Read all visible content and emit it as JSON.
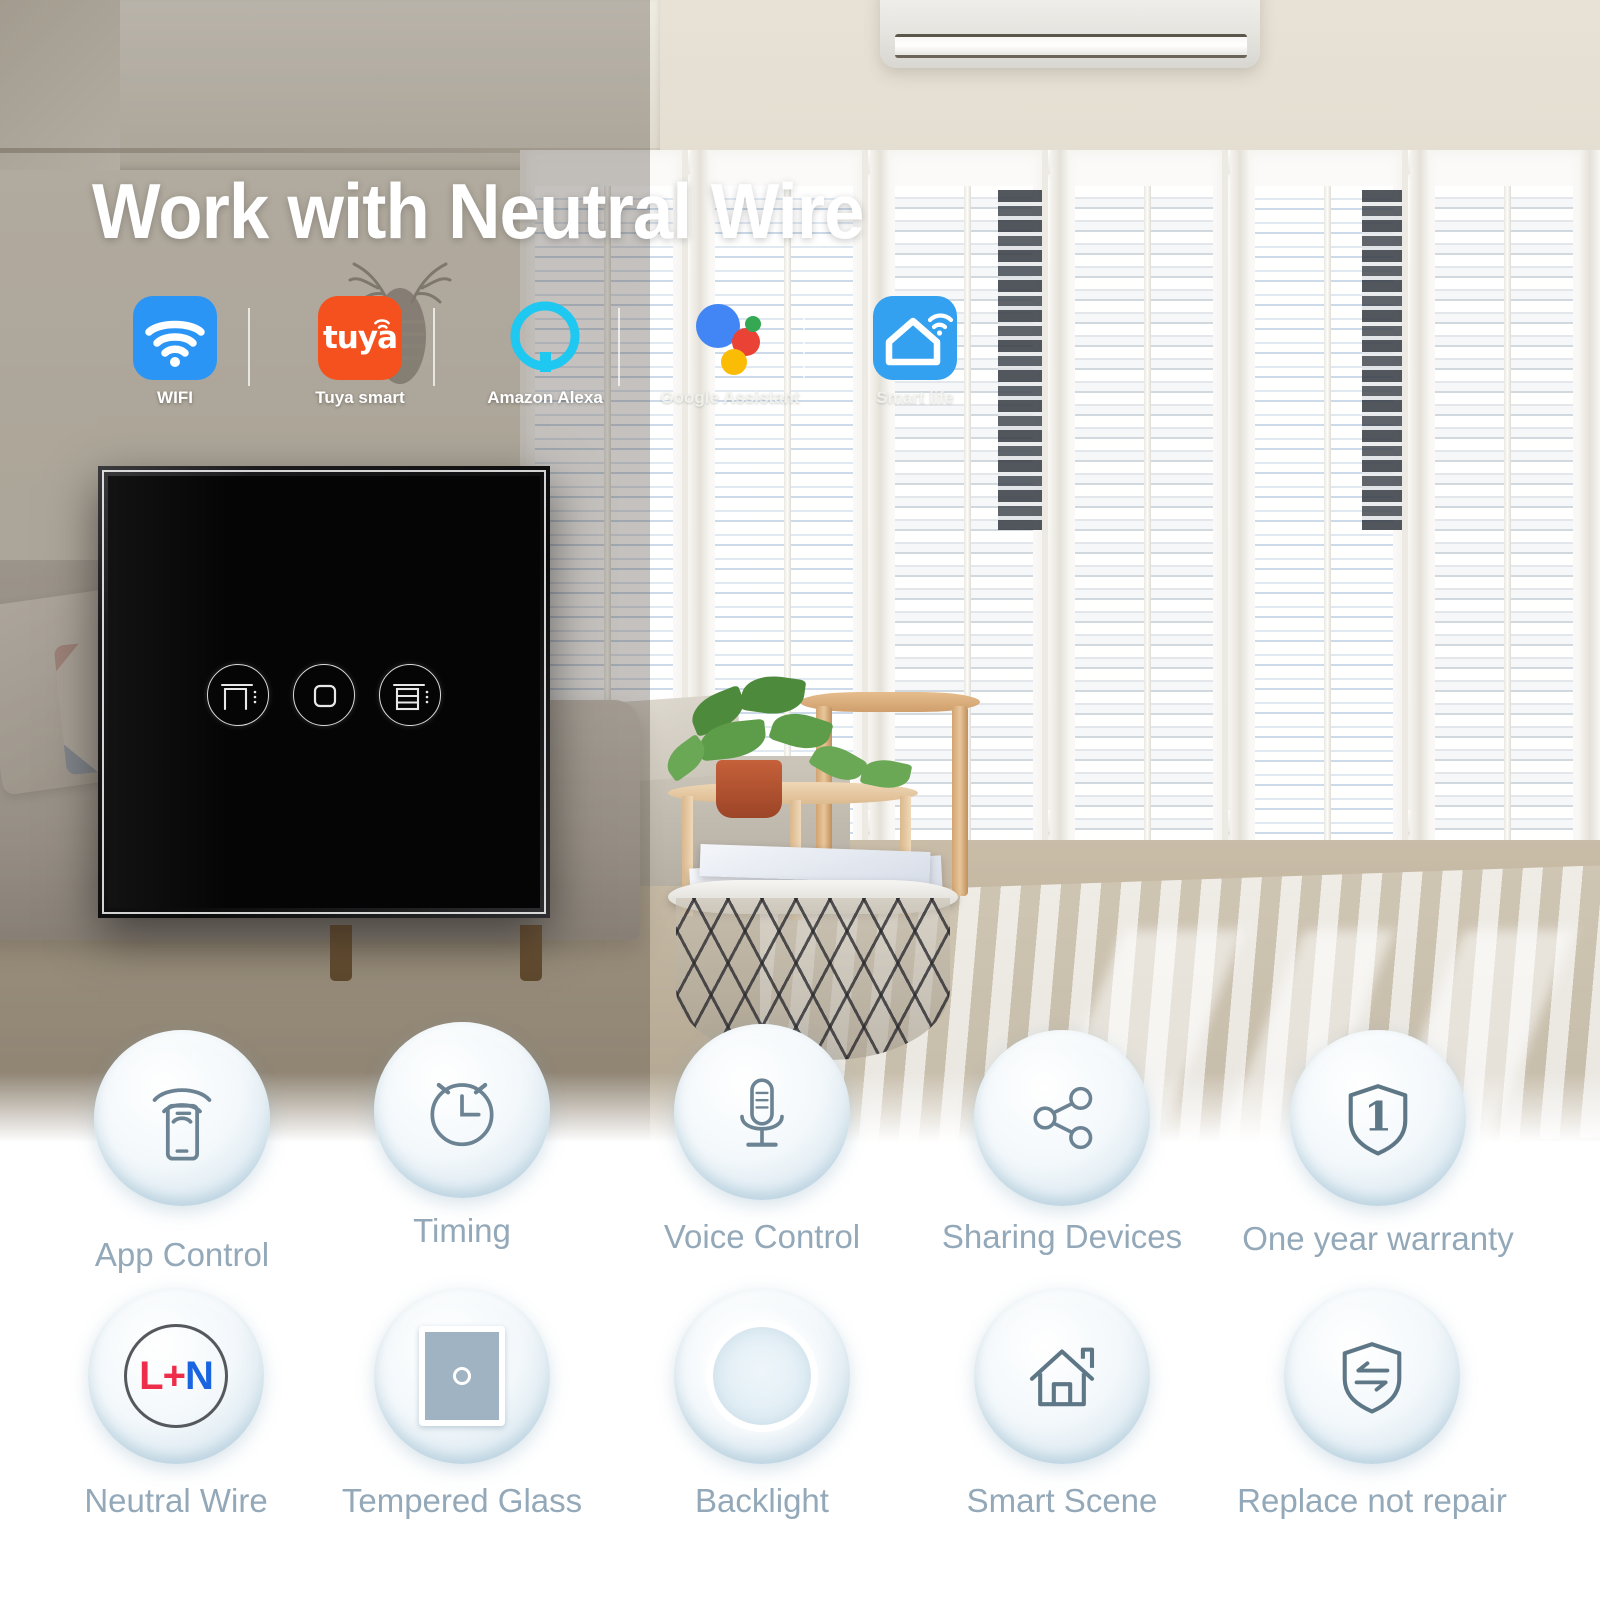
{
  "headline": "Work with Neutral Wire",
  "colors": {
    "wifi_blue": "#2a95f5",
    "tuya_orange": "#f4511e",
    "alexa_cyan": "#00c8f0",
    "smartlife_blue": "#34a0f0",
    "google_blue": "#4285f4",
    "google_red": "#ea4335",
    "google_yellow": "#fbbc05",
    "google_green": "#34a853",
    "label_gray_blue": "#93a8b8",
    "live_wire_red": "#ee2d4a",
    "neutral_wire_blue": "#1964e0",
    "panel_black": "#050505"
  },
  "platforms": [
    {
      "label": "WIFI",
      "icon": "wifi-icon"
    },
    {
      "label": "Tuya smart",
      "icon": "tuya-icon",
      "wordmark": "tuya"
    },
    {
      "label": "Amazon Alexa",
      "icon": "amazon-alexa-icon"
    },
    {
      "label": "Google Assistant",
      "icon": "google-assistant-icon"
    },
    {
      "label": "Smart life",
      "icon": "smart-life-icon"
    }
  ],
  "switch_panel": {
    "buttons": [
      {
        "name": "curtain-open-button",
        "icon": "curtain-open-icon"
      },
      {
        "name": "curtain-stop-button",
        "icon": "curtain-stop-icon"
      },
      {
        "name": "curtain-close-button",
        "icon": "curtain-close-icon"
      }
    ]
  },
  "features": [
    {
      "label": "App Control",
      "icon": "phone-signal-icon"
    },
    {
      "label": "Timing",
      "icon": "alarm-clock-icon"
    },
    {
      "label": "Voice Control",
      "icon": "microphone-icon"
    },
    {
      "label": "Sharing Devices",
      "icon": "share-nodes-icon"
    },
    {
      "label": "One year warranty",
      "icon": "shield-one-icon",
      "badge": "1"
    },
    {
      "label": "Neutral Wire",
      "icon": "l-plus-n-icon",
      "l": "L",
      "plus": "+",
      "n": "N"
    },
    {
      "label": "Tempered Glass",
      "icon": "glass-panel-icon"
    },
    {
      "label": "Backlight",
      "icon": "backlight-ring-icon"
    },
    {
      "label": "Smart Scene",
      "icon": "house-icon"
    },
    {
      "label": "Replace not repair",
      "icon": "shield-swap-icon"
    }
  ]
}
